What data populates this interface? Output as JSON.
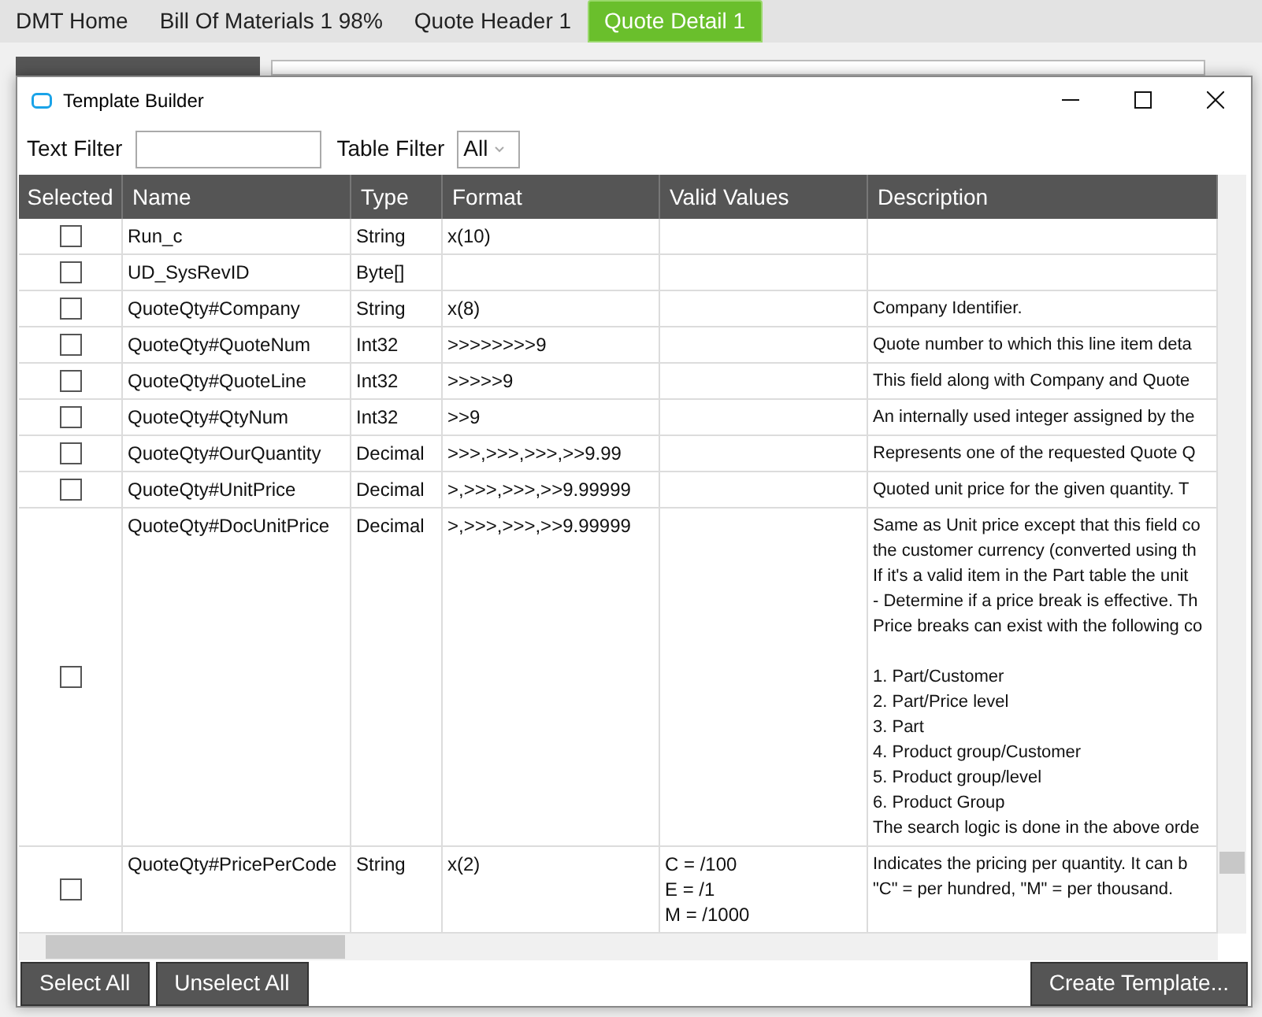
{
  "app_tabs": [
    {
      "label": "DMT Home",
      "selected": false
    },
    {
      "label": "Bill Of Materials 1 98%",
      "selected": false
    },
    {
      "label": "Quote Header 1",
      "selected": false
    },
    {
      "label": "Quote Detail 1",
      "selected": true
    }
  ],
  "dialog": {
    "title": "Template Builder",
    "text_filter": {
      "label": "Text Filter"
    },
    "table_filter": {
      "label": "Table Filter",
      "value": "All"
    },
    "table": {
      "columns": [
        "Selected",
        "Name",
        "Type",
        "Format",
        "Valid Values",
        "Description"
      ],
      "rows": [
        {
          "selected": false,
          "name": "Run_c",
          "type": "String",
          "format": "x(10)"
        },
        {
          "selected": false,
          "name": "UD_SysRevID",
          "type": "Byte[]"
        },
        {
          "selected": false,
          "name": "QuoteQty#Company",
          "type": "String",
          "format": "x(8)",
          "description": [
            [
              "Company Identifier."
            ]
          ]
        },
        {
          "selected": false,
          "name": "QuoteQty#QuoteNum",
          "type": "Int32",
          "format": ">>>>>>>>9",
          "description": [
            [
              "Quote number to which this line item deta"
            ]
          ]
        },
        {
          "selected": false,
          "name": "QuoteQty#QuoteLine",
          "type": "Int32",
          "format": ">>>>>9",
          "description": [
            [
              "This field along with Company and Quote"
            ]
          ]
        },
        {
          "selected": false,
          "name": "QuoteQty#QtyNum",
          "type": "Int32",
          "format": ">>9",
          "description": [
            [
              "An internally used integer assigned by the"
            ]
          ]
        },
        {
          "selected": false,
          "name": "QuoteQty#OurQuantity",
          "type": "Decimal",
          "format": ">>>,>>>,>>>,>>9.99",
          "description": [
            [
              "Represents one of the requested Quote Q"
            ]
          ]
        },
        {
          "selected": false,
          "name": "QuoteQty#UnitPrice",
          "type": "Decimal",
          "format": ">,>>>,>>>,>>9.99999",
          "description": [
            [
              "Quoted unit price for the given quantity. T"
            ]
          ]
        },
        {
          "selected": false,
          "name": "QuoteQty#DocUnitPrice",
          "type": "Decimal",
          "format": ">,>>>,>>>,>>9.99999",
          "description": [
            [
              "Same as Unit price except that this field co",
              "the customer currency (converted using th",
              "If it's a valid item in the Part table the unit",
              "- Determine if a price break is effective. Th",
              "Price breaks can exist with the following co"
            ],
            [
              "1. Part/Customer",
              "2. Part/Price level",
              "3. Part",
              "4. Product group/Customer",
              "5. Product group/level",
              "6. Product Group",
              "The search logic is done in the above orde"
            ]
          ]
        },
        {
          "selected": false,
          "name": "QuoteQty#PricePerCode",
          "type": "String",
          "format": "x(2)",
          "valid_values": [
            "C = /100",
            "E = /1",
            "M = /1000"
          ],
          "description": [
            [
              "Indicates the pricing per quantity. It can b",
              "\"C\" = per hundred,  \"M\" = per thousand."
            ]
          ]
        }
      ]
    },
    "buttons_left": [
      "Select All",
      "Unselect All"
    ],
    "button_right": "Create Template..."
  }
}
